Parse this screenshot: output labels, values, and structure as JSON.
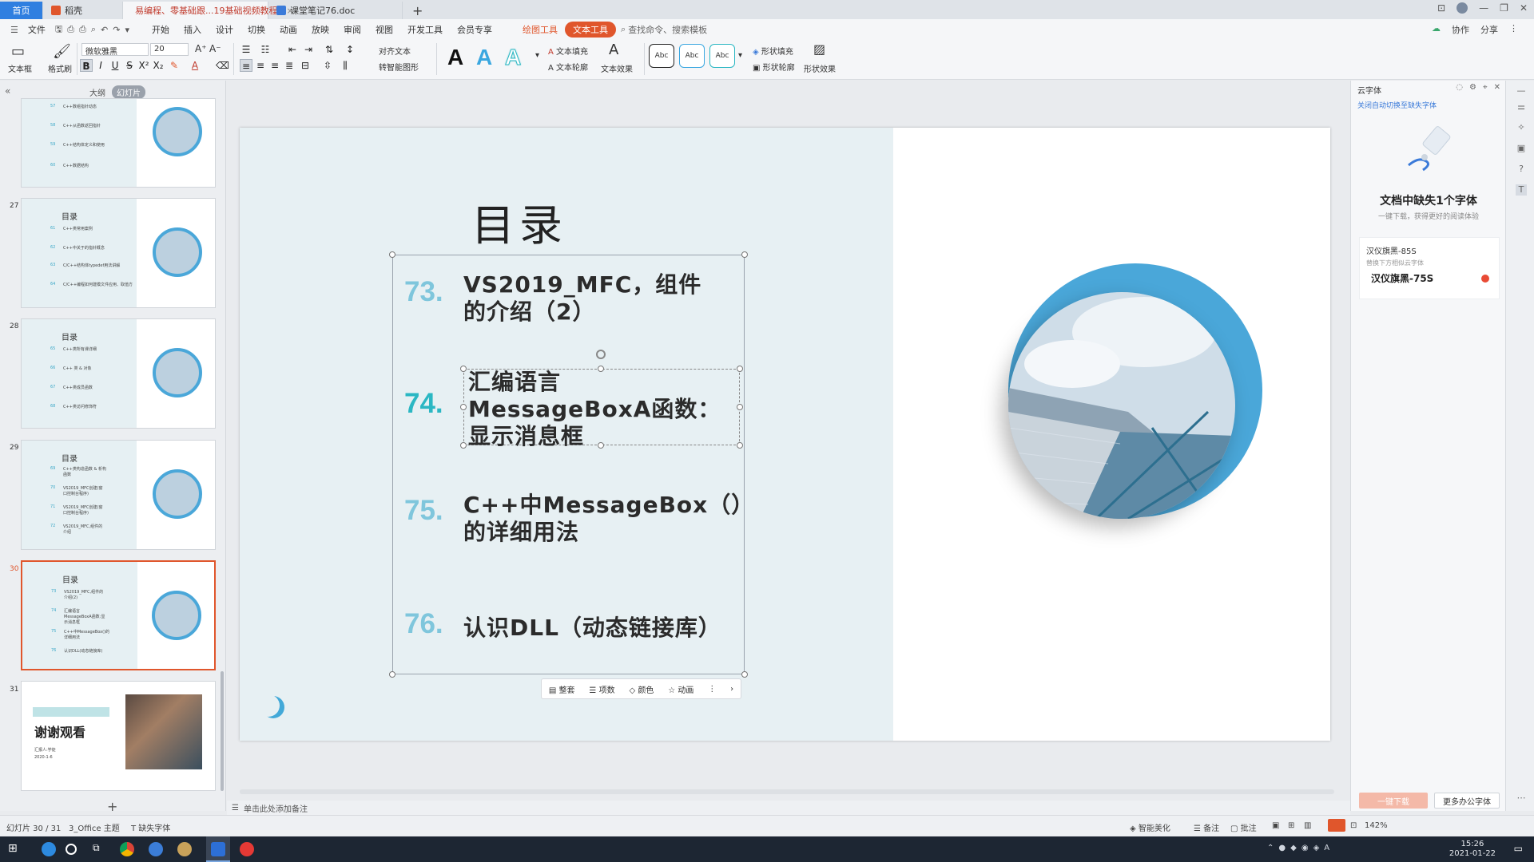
{
  "tabs": {
    "home": "首页",
    "t1": "稻壳",
    "t2": "易编程、零基础跟...19基础视频教程",
    "t3": "课堂笔记76.doc",
    "plus": "+"
  },
  "menu": {
    "file": "文件",
    "items": [
      "开始",
      "插入",
      "设计",
      "切换",
      "动画",
      "放映",
      "审阅",
      "视图",
      "开发工具",
      "会员专享"
    ],
    "ctx_draw": "绘图工具",
    "ctx_text": "文本工具",
    "search": "查找命令、搜索模板",
    "right": [
      "协作",
      "分享"
    ]
  },
  "ribbon": {
    "textbox": "文本框",
    "format_painter": "格式刷",
    "font_name": "微软雅黑",
    "font_size": "20",
    "align_text": "对齐文本",
    "to_smartart": "转智能图形",
    "text_fill": "文本填充",
    "text_outline": "文本轮廓",
    "text_effect": "文本效果",
    "shape_fill": "形状填充",
    "shape_outline": "形状轮廓",
    "shape_effect": "形状效果",
    "style_A": "A",
    "abc": "Abc"
  },
  "left_panel": {
    "tab_outline": "大纲",
    "tab_slides": "幻灯片",
    "collapse": "«",
    "thumbs": [
      {
        "no": "",
        "title": "",
        "lines": [
          [
            "57",
            "C++数组指针动态"
          ],
          [
            "58",
            "C++从函数返回指针"
          ],
          [
            "59",
            "C++结构体定义和使用"
          ],
          [
            "60",
            "C++数据结构"
          ]
        ]
      },
      {
        "no": "27",
        "title": "目录",
        "lines": [
          [
            "61",
            "C++类常用案例"
          ],
          [
            "62",
            "C++中关于的指针概念"
          ],
          [
            "63",
            "C/C++结构体typedef用法讲解"
          ],
          [
            "64",
            "C/C++编程如何建模文件应用、取值方"
          ]
        ]
      },
      {
        "no": "28",
        "title": "目录",
        "lines": [
          [
            "65",
            "C++类所有课详细"
          ],
          [
            "66",
            "C++ 类 & 对象"
          ],
          [
            "67",
            "C++类成员函数"
          ],
          [
            "68",
            "C++类访问修饰符"
          ]
        ]
      },
      {
        "no": "29",
        "title": "目录",
        "lines": [
          [
            "69",
            "C++类构造函数 & 析构函数"
          ],
          [
            "70",
            "VS2019_MFC创建(窗口控制台程序)"
          ],
          [
            "71",
            "VS2019_MFC创建(窗口控制台程序)"
          ],
          [
            "72",
            "VS2019_MFC,组件的介绍"
          ]
        ]
      },
      {
        "no": "30",
        "title": "目录",
        "lines": [
          [
            "73",
            "VS2019_MFC,组件的介绍(2)"
          ],
          [
            "74",
            "汇编语言MessageBoxA函数:显示消息框"
          ],
          [
            "75",
            "C++中MessageBox()的详细用法"
          ],
          [
            "76",
            "认识DLL(动态链接库)"
          ]
        ]
      },
      {
        "no": "31",
        "title": "谢谢观看",
        "lines": [
          [
            "",
            "汇报人:学徒"
          ],
          [
            "",
            "2020-1-6"
          ]
        ]
      }
    ],
    "add": "+"
  },
  "slide": {
    "title": "目录",
    "items": [
      {
        "num": "73.",
        "text": "VS2019_MFC，组件\n的介绍（2）"
      },
      {
        "num": "74.",
        "text": "汇编语言\nMessageBoxA函数：\n显示消息框"
      },
      {
        "num": "75.",
        "text": "C++中MessageBox（）\n的详细用法"
      },
      {
        "num": "76.",
        "text": "认识DLL（动态链接库）"
      }
    ],
    "float_bar": [
      "整套",
      "项数",
      "颜色",
      "动画"
    ]
  },
  "notes": "单击此处添加备注",
  "right_panel": {
    "title": "云字体",
    "link": "关闭自动切换至缺失字体",
    "heading": "文档中缺失1个字体",
    "sub": "一键下载，获得更好的阅读体验",
    "missing_font": "汉仪旗黑-85S",
    "hint": "替换下方相似云字体",
    "suggest_font": "汉仪旗黑-75S",
    "btn_download": "一键下载",
    "btn_more": "更多办公字体"
  },
  "status": {
    "slide_no": "幻灯片 30 / 31",
    "theme": "3_Office 主题",
    "missing": "缺失字体",
    "beautify": "智能美化",
    "notes": "备注",
    "comments": "批注",
    "zoom": "142%"
  },
  "taskbar": {
    "time": "15:26",
    "date": "2021-01-22"
  },
  "colors": {
    "accent": "#e0562c",
    "teal": "#2bb7c3",
    "blue": "#4aa7d9"
  }
}
